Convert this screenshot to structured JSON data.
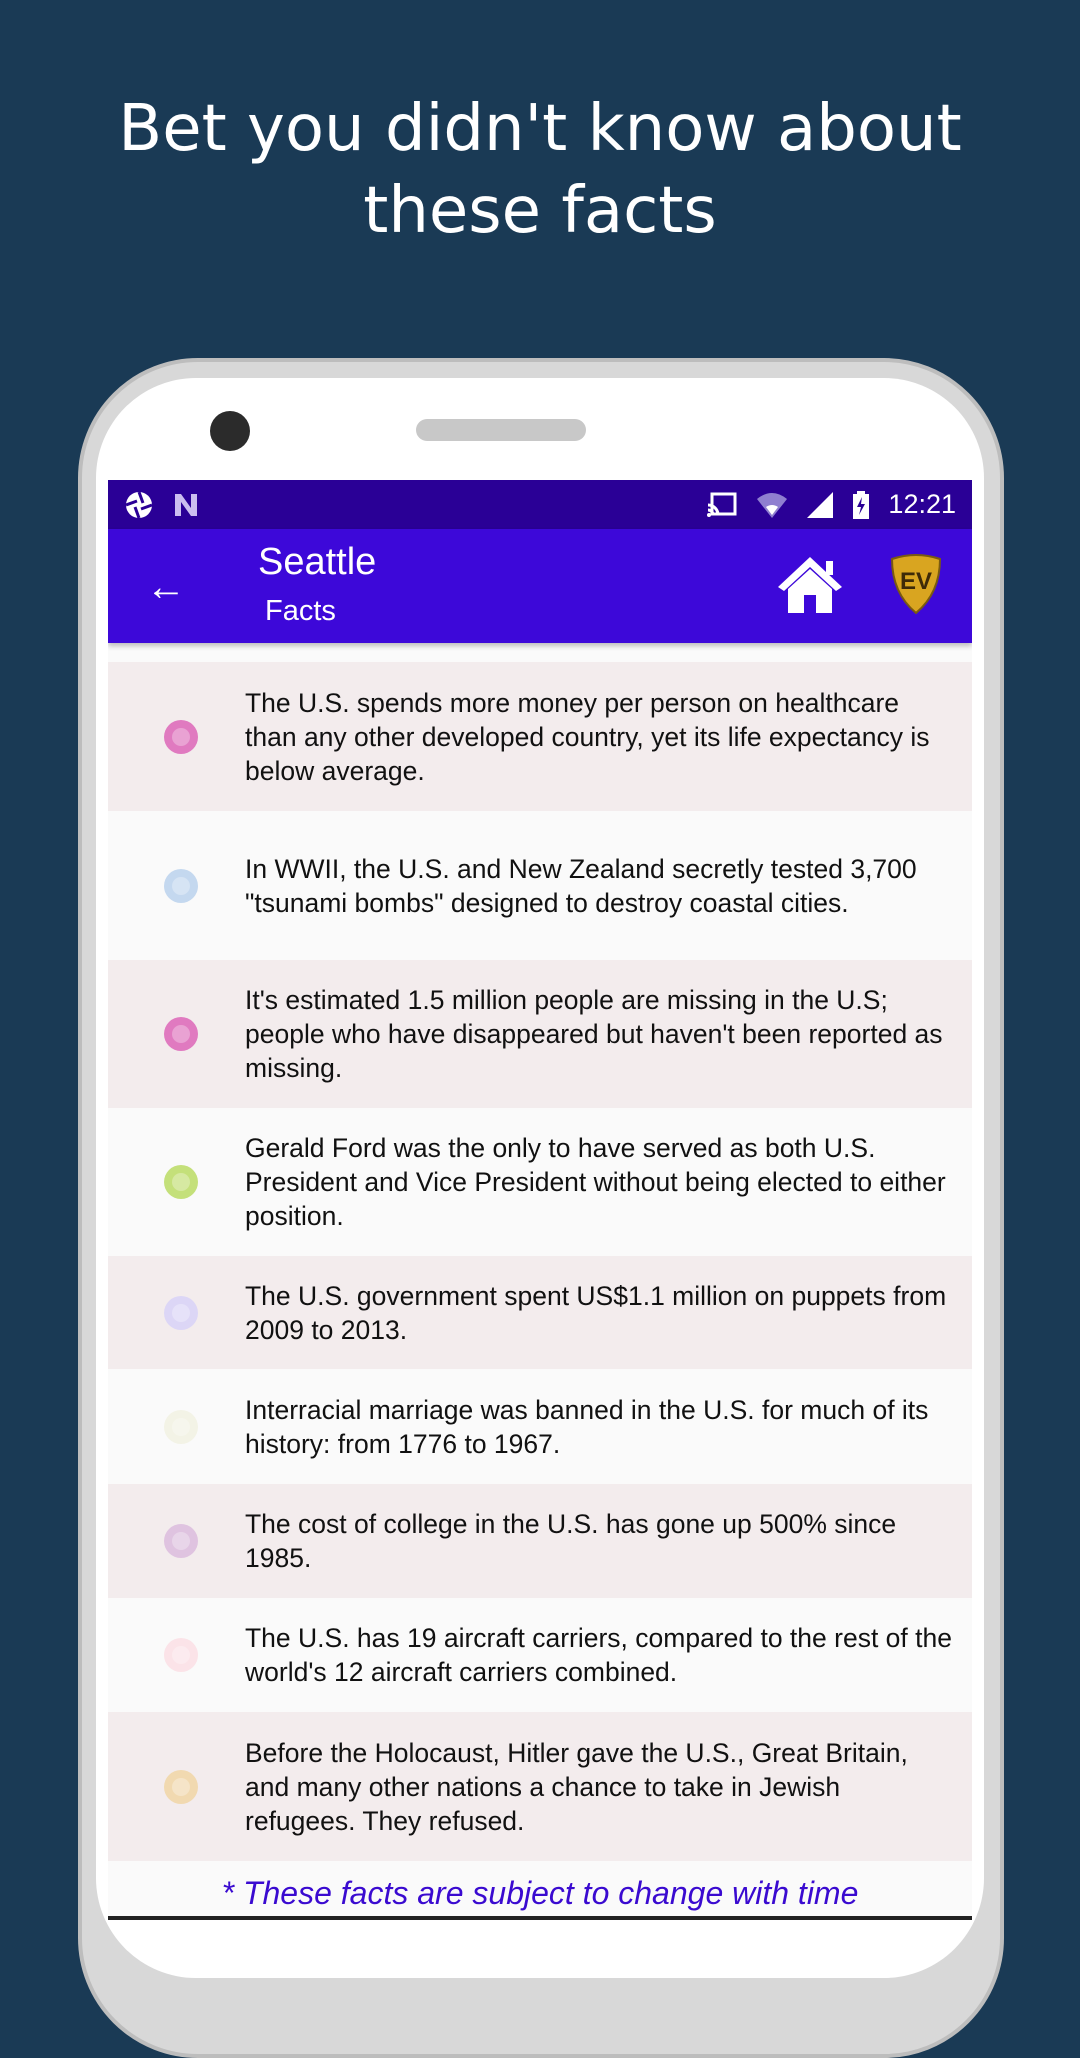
{
  "headline": {
    "line1": "Bet you didn't know about",
    "line2": "these facts"
  },
  "status_bar": {
    "time": "12:21",
    "icons": [
      "aperture-icon",
      "n-icon",
      "cast-icon",
      "wifi-icon",
      "signal-icon",
      "battery-charging-icon"
    ]
  },
  "app_bar": {
    "title": "Seattle",
    "subtitle": "Facts",
    "icons": [
      "back-arrow-icon",
      "home-icon",
      "ev-logo-icon"
    ]
  },
  "facts": [
    {
      "text": "The U.S. spends more money per person on healthcare than any other developed country, yet its life expectancy is below average.",
      "color": "#e07ac0"
    },
    {
      "text": "In WWII, the U.S. and New Zealand secretly tested 3,700 \"tsunami bombs\" designed to destroy coastal cities.",
      "color": "#c4d8ef"
    },
    {
      "text": "It's estimated 1.5 million people are missing in the U.S; people who have disappeared but haven't been reported as missing.",
      "color": "#e07ac0"
    },
    {
      "text": "Gerald Ford was the only to have served as both U.S. President and Vice President without being elected to either position.",
      "color": "#c4e07a"
    },
    {
      "text": "The U.S. government spent US$1.1 million on puppets from 2009 to 2013.",
      "color": "#dcd6f6"
    },
    {
      "text": "Interracial marriage was banned in the U.S. for much of its history: from 1776 to 1967.",
      "color": "#f3f3e6"
    },
    {
      "text": "The cost of college in the U.S. has gone up 500% since 1985.",
      "color": "#dfc3e0"
    },
    {
      "text": "The U.S. has 19 aircraft carriers, compared to the rest of the world's 12 aircraft carriers combined.",
      "color": "#fbe3e8"
    },
    {
      "text": "Before the Holocaust, Hitler gave the U.S., Great Britain, and many other nations a chance to take in Jewish refugees. They refused.",
      "color": "#f1d9b0"
    }
  ],
  "footer": "* These facts are subject to change with time",
  "colors": {
    "background": "#1a3a55",
    "status_bar": "#2a0096",
    "app_bar": "#3d08d9",
    "footer_text": "#3a0ad0"
  }
}
